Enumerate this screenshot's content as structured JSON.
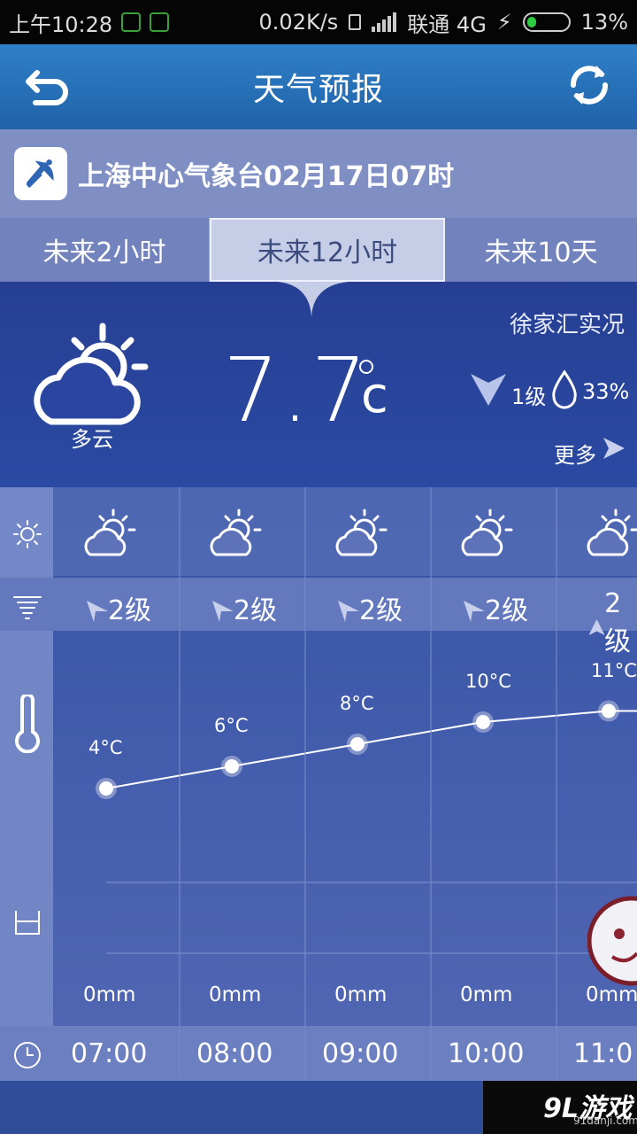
{
  "status_bar": {
    "time": "上午10:28",
    "speed": "0.02K/s",
    "carrier": "联通 4G",
    "battery": "13%"
  },
  "header": {
    "title": "天气预报",
    "back_icon": "back-arrow-icon",
    "refresh_icon": "refresh-icon"
  },
  "source": {
    "text": "上海中心气象台02月17日07时",
    "logo_icon": "satellite-dish-icon"
  },
  "tabs": [
    {
      "label": "未来2小时",
      "active": false
    },
    {
      "label": "未来12小时",
      "active": true
    },
    {
      "label": "未来10天",
      "active": false
    }
  ],
  "current": {
    "condition": "多云",
    "temperature": "7.7",
    "unit": "c",
    "station": "徐家汇实况",
    "wind": "1级",
    "humidity": "33%",
    "more": "更多"
  },
  "forecast": {
    "columns": [
      {
        "time": "07:00",
        "wind": "2级",
        "temp": "4°C",
        "temp_value": 4,
        "rain": "0mm",
        "wind_dir": "down-right"
      },
      {
        "time": "08:00",
        "wind": "2级",
        "temp": "6°C",
        "temp_value": 6,
        "rain": "0mm",
        "wind_dir": "down-right"
      },
      {
        "time": "09:00",
        "wind": "2级",
        "temp": "8°C",
        "temp_value": 8,
        "rain": "0mm",
        "wind_dir": "down-right"
      },
      {
        "time": "10:00",
        "wind": "2级",
        "temp": "10°C",
        "temp_value": 10,
        "rain": "0mm",
        "wind_dir": "down-right"
      },
      {
        "time": "11:0",
        "wind": "2级",
        "temp": "11°C",
        "temp_value": 11,
        "rain": "0mm",
        "wind_dir": "up"
      }
    ]
  },
  "watermark": {
    "brand": "9L游戏",
    "site": "91danji.com"
  },
  "colors": {
    "header": "#2f80c8",
    "panel": "#263f93",
    "grid": "#3753a6"
  }
}
